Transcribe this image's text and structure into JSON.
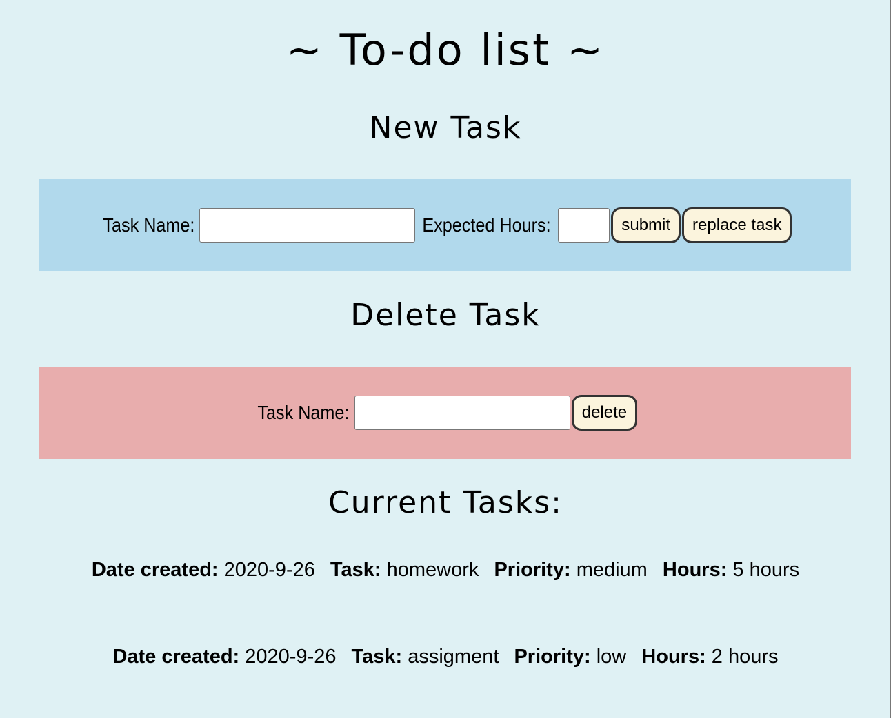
{
  "title": "~ To-do list ~",
  "new_task": {
    "heading": "New Task",
    "task_name_label": "Task Name:",
    "expected_hours_label": "Expected Hours:",
    "task_name_value": "",
    "expected_hours_value": "",
    "submit_label": "submit",
    "replace_label": "replace task"
  },
  "delete_task": {
    "heading": "Delete Task",
    "task_name_label": "Task Name:",
    "task_name_value": "",
    "delete_label": "delete"
  },
  "current": {
    "heading": "Current Tasks:",
    "field_labels": {
      "date": "Date created:",
      "task": "Task:",
      "priority": "Priority:",
      "hours": "Hours:"
    },
    "tasks": [
      {
        "date": "2020-9-26",
        "task": "homework",
        "priority": "medium",
        "hours": "5 hours"
      },
      {
        "date": "2020-9-26",
        "task": "assigment",
        "priority": "low",
        "hours": "2 hours"
      }
    ]
  },
  "colors": {
    "background": "#dff1f4",
    "new_panel": "#b1d9ec",
    "delete_panel": "#e8adad",
    "button": "#fbf4dd"
  }
}
